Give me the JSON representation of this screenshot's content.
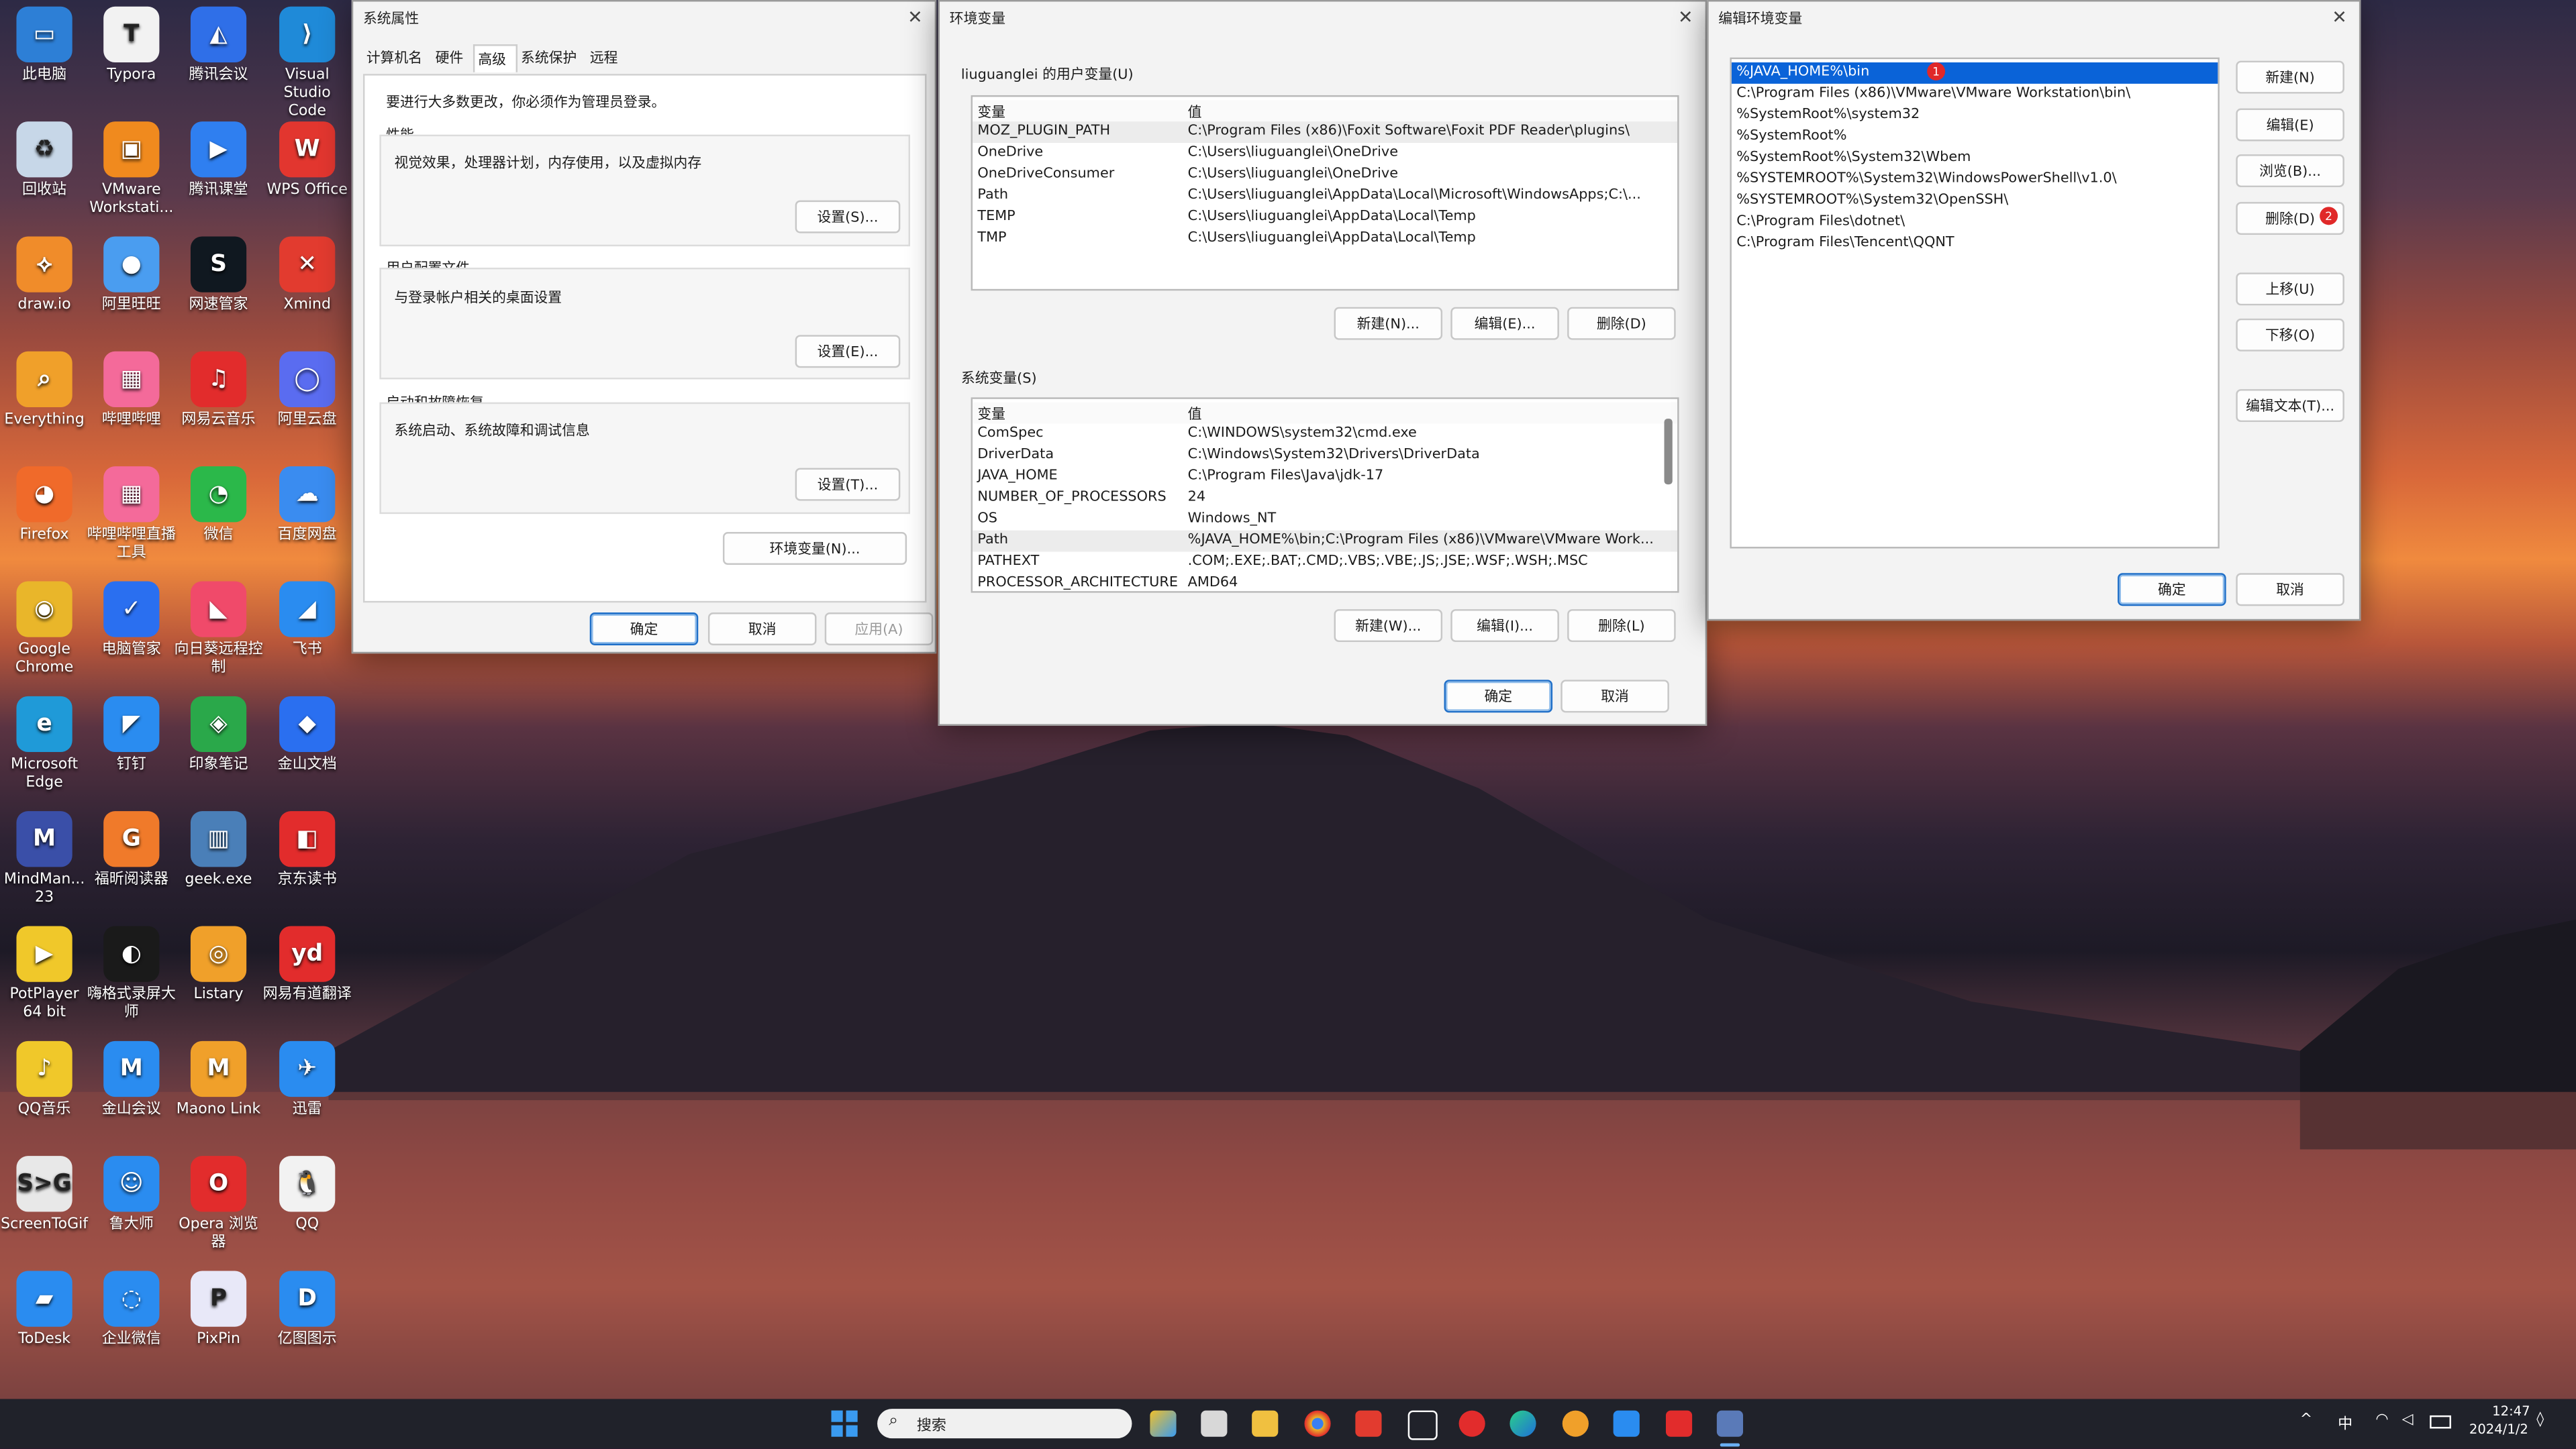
{
  "desktop": {
    "icons": [
      {
        "label": "此电脑",
        "color": "#2d7fd6",
        "glyph": "▭"
      },
      {
        "label": "Typora",
        "color": "#f2f2f2",
        "glyph": "T"
      },
      {
        "label": "腾讯会议",
        "color": "#2f6fe8",
        "glyph": "◭"
      },
      {
        "label": "Visual Studio Code",
        "color": "#1f8ad8",
        "glyph": "⟩"
      },
      {
        "label": "回收站",
        "color": "#c7d7e8",
        "glyph": "♻"
      },
      {
        "label": "VMware Workstati...",
        "color": "#f08a1e",
        "glyph": "▣"
      },
      {
        "label": "腾讯课堂",
        "color": "#2f7ff0",
        "glyph": "▶"
      },
      {
        "label": "WPS Office",
        "color": "#e2362f",
        "glyph": "W"
      },
      {
        "label": "draw.io",
        "color": "#f08c2a",
        "glyph": "⟡"
      },
      {
        "label": "阿里旺旺",
        "color": "#4a9df0",
        "glyph": "●"
      },
      {
        "label": "网速管家",
        "color": "#101820",
        "glyph": "S"
      },
      {
        "label": "Xmind",
        "color": "#e23b2f",
        "glyph": "✕"
      },
      {
        "label": "Everything",
        "color": "#f0a02a",
        "glyph": "⌕"
      },
      {
        "label": "哔哩哔哩",
        "color": "#f46a9a",
        "glyph": "▦"
      },
      {
        "label": "网易云音乐",
        "color": "#e22c2c",
        "glyph": "♫"
      },
      {
        "label": "阿里云盘",
        "color": "#5a6cf0",
        "glyph": "◯"
      },
      {
        "label": "Firefox",
        "color": "#f06a2a",
        "glyph": "◕"
      },
      {
        "label": "哔哩哔哩直播工具",
        "color": "#f46a9a",
        "glyph": "▦"
      },
      {
        "label": "微信",
        "color": "#2bb84a",
        "glyph": "◔"
      },
      {
        "label": "百度网盘",
        "color": "#3a8cf0",
        "glyph": "☁"
      },
      {
        "label": "Google Chrome",
        "color": "#e9b62a",
        "glyph": "◉"
      },
      {
        "label": "电脑管家",
        "color": "#2a6ff0",
        "glyph": "✓"
      },
      {
        "label": "向日葵远程控制",
        "color": "#f04a6a",
        "glyph": "◣"
      },
      {
        "label": "飞书",
        "color": "#2a8cf0",
        "glyph": "◢"
      },
      {
        "label": "Microsoft Edge",
        "color": "#1f9ad8",
        "glyph": "e"
      },
      {
        "label": "钉钉",
        "color": "#2a8cf0",
        "glyph": "◤"
      },
      {
        "label": "印象笔记",
        "color": "#2aa84a",
        "glyph": "◈"
      },
      {
        "label": "金山文档",
        "color": "#2a6ff0",
        "glyph": "◆"
      },
      {
        "label": "MindMan... 23",
        "color": "#3a4fa8",
        "glyph": "M"
      },
      {
        "label": "福昕阅读器",
        "color": "#f07a2a",
        "glyph": "G"
      },
      {
        "label": "geek.exe",
        "color": "#4a7fb8",
        "glyph": "▥"
      },
      {
        "label": "京东读书",
        "color": "#e22c2c",
        "glyph": "◧"
      },
      {
        "label": "PotPlayer 64 bit",
        "color": "#f0c82a",
        "glyph": "▶"
      },
      {
        "label": "嗨格式录屏大师",
        "color": "#1a1a1a",
        "glyph": "◐"
      },
      {
        "label": "Listary",
        "color": "#f0a02a",
        "glyph": "◎"
      },
      {
        "label": "网易有道翻译",
        "color": "#e22c2c",
        "glyph": "yd"
      },
      {
        "label": "QQ音乐",
        "color": "#f0c82a",
        "glyph": "♪"
      },
      {
        "label": "金山会议",
        "color": "#2a8cf0",
        "glyph": "M"
      },
      {
        "label": "Maono Link",
        "color": "#f0a02a",
        "glyph": "M"
      },
      {
        "label": "迅雷",
        "color": "#2a8cf0",
        "glyph": "✈"
      },
      {
        "label": "ScreenToGif",
        "color": "#e8e8e8",
        "glyph": "S>G"
      },
      {
        "label": "鲁大师",
        "color": "#2a8cf0",
        "glyph": "☺"
      },
      {
        "label": "Opera 浏览器",
        "color": "#e22c2c",
        "glyph": "O"
      },
      {
        "label": "QQ",
        "color": "#f2f2f2",
        "glyph": "🐧"
      },
      {
        "label": "ToDesk",
        "color": "#2a8cf0",
        "glyph": "▰"
      },
      {
        "label": "企业微信",
        "color": "#2a8cf0",
        "glyph": "◌"
      },
      {
        "label": "PixPin",
        "color": "#e8e8f8",
        "glyph": "P"
      },
      {
        "label": "亿图图示",
        "color": "#2a8cf0",
        "glyph": "D"
      }
    ]
  },
  "sysprops": {
    "title": "系统属性",
    "tabs": [
      "计算机名",
      "硬件",
      "高级",
      "系统保护",
      "远程"
    ],
    "admin_note": "要进行大多数更改，你必须作为管理员登录。",
    "perf_title": "性能",
    "perf_desc": "视觉效果，处理器计划，内存使用，以及虚拟内存",
    "perf_btn": "设置(S)...",
    "profile_title": "用户配置文件",
    "profile_desc": "与登录帐户相关的桌面设置",
    "profile_btn": "设置(E)...",
    "startup_title": "启动和故障恢复",
    "startup_desc": "系统启动、系统故障和调试信息",
    "startup_btn": "设置(T)...",
    "envvars_btn": "环境变量(N)...",
    "ok": "确定",
    "cancel": "取消",
    "apply": "应用(A)"
  },
  "envvars": {
    "title": "环境变量",
    "user_section": "liuguanglei 的用户变量(U)",
    "col_var": "变量",
    "col_val": "值",
    "user_rows": [
      {
        "name": "MOZ_PLUGIN_PATH",
        "value": "C:\\Program Files (x86)\\Foxit Software\\Foxit PDF Reader\\plugins\\"
      },
      {
        "name": "OneDrive",
        "value": "C:\\Users\\liuguanglei\\OneDrive"
      },
      {
        "name": "OneDriveConsumer",
        "value": "C:\\Users\\liuguanglei\\OneDrive"
      },
      {
        "name": "Path",
        "value": "C:\\Users\\liuguanglei\\AppData\\Local\\Microsoft\\WindowsApps;C:\\..."
      },
      {
        "name": "TEMP",
        "value": "C:\\Users\\liuguanglei\\AppData\\Local\\Temp"
      },
      {
        "name": "TMP",
        "value": "C:\\Users\\liuguanglei\\AppData\\Local\\Temp"
      }
    ],
    "user_new": "新建(N)...",
    "user_edit": "编辑(E)...",
    "user_delete": "删除(D)",
    "sys_section": "系统变量(S)",
    "sys_rows": [
      {
        "name": "ComSpec",
        "value": "C:\\WINDOWS\\system32\\cmd.exe"
      },
      {
        "name": "DriverData",
        "value": "C:\\Windows\\System32\\Drivers\\DriverData"
      },
      {
        "name": "JAVA_HOME",
        "value": "C:\\Program Files\\Java\\jdk-17"
      },
      {
        "name": "NUMBER_OF_PROCESSORS",
        "value": "24"
      },
      {
        "name": "OS",
        "value": "Windows_NT"
      },
      {
        "name": "Path",
        "value": "%JAVA_HOME%\\bin;C:\\Program Files (x86)\\VMware\\VMware Work..."
      },
      {
        "name": "PATHEXT",
        "value": ".COM;.EXE;.BAT;.CMD;.VBS;.VBE;.JS;.JSE;.WSF;.WSH;.MSC"
      },
      {
        "name": "PROCESSOR_ARCHITECTURE",
        "value": "AMD64"
      }
    ],
    "sys_new": "新建(W)...",
    "sys_edit": "编辑(I)...",
    "sys_delete": "删除(L)",
    "ok": "确定",
    "cancel": "取消"
  },
  "editenv": {
    "title": "编辑环境变量",
    "entries": [
      "%JAVA_HOME%\\bin",
      "C:\\Program Files (x86)\\VMware\\VMware Workstation\\bin\\",
      "%SystemRoot%\\system32",
      "%SystemRoot%",
      "%SystemRoot%\\System32\\Wbem",
      "%SYSTEMROOT%\\System32\\WindowsPowerShell\\v1.0\\",
      "%SYSTEMROOT%\\System32\\OpenSSH\\",
      "C:\\Program Files\\dotnet\\",
      "C:\\Program Files\\Tencent\\QQNT"
    ],
    "badge1": "1",
    "badge2": "2",
    "new": "新建(N)",
    "edit": "编辑(E)",
    "browse": "浏览(B)...",
    "delete": "删除(D)",
    "up": "上移(U)",
    "down": "下移(O)",
    "edit_text": "编辑文本(T)...",
    "ok": "确定",
    "cancel": "取消"
  },
  "taskbar": {
    "search_placeholder": "搜索",
    "ime": "中",
    "time": "12:47",
    "date": "2024/1/2"
  }
}
